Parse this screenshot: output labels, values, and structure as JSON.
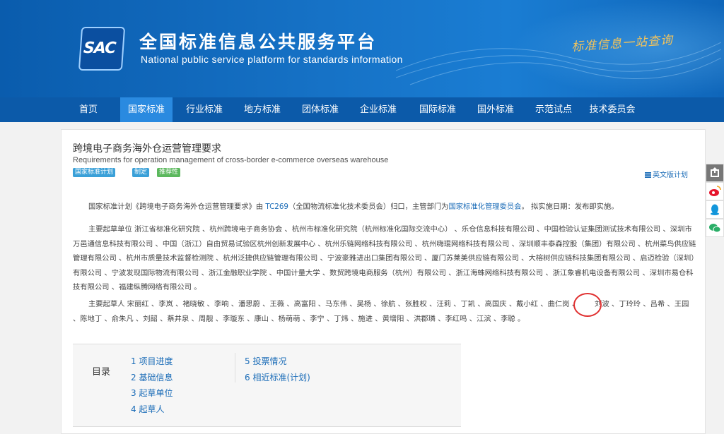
{
  "header": {
    "logo_text": "SAC",
    "title_cn": "全国标准信息公共服务平台",
    "title_en": "National public service platform  for standards information",
    "slogan": "标准信息一站查询"
  },
  "nav": {
    "items": [
      {
        "label": "首页"
      },
      {
        "label": "国家标准"
      },
      {
        "label": "行业标准"
      },
      {
        "label": "地方标准"
      },
      {
        "label": "团体标准"
      },
      {
        "label": "企业标准"
      },
      {
        "label": "国际标准"
      },
      {
        "label": "国外标准"
      },
      {
        "label": "示范试点"
      },
      {
        "label": "技术委员会"
      }
    ],
    "active_index": 1
  },
  "standard": {
    "title": "跨境电子商务海外仓运营管理要求",
    "title_en": "Requirements for operation management of cross-border e-commerce overseas warehouse",
    "tags": [
      "国家标准计划",
      "制定",
      "推荐性"
    ],
    "english_plan_link": "英文版计划"
  },
  "description": {
    "p1_prefix": "国家标准计划《跨境电子商务海外仓运营管理要求》由 ",
    "tc_code": "TC269",
    "p1_mid": "（全国物流标准化技术委员会）归口，主管部门为",
    "dept_link": "国家标准化管理委员会",
    "p1_suffix": "。 拟实施日期：发布即实施。",
    "p2": "主要起草单位 浙江省标准化研究院 、杭州跨境电子商务协会 、杭州市标准化研究院（杭州标准化国际交流中心） 、乐仓信息科技有限公司 、中国检验认证集团测试技术有限公司 、深圳市万邑通信息科技有限公司 、中国（浙江）自由贸易试验区杭州创新发展中心 、杭州乐链网络科技有限公司 、杭州嗨琨网络科技有限公司 、深圳顺丰泰森控股（集团）有限公司 、杭州菜鸟供应链管理有限公司 、杭州市质量技术监督检测院 、杭州泛捷供应链管理有限公司 、宁波豪雅进出口集团有限公司 、厦门苏莱美供应链有限公司 、大榕树供应链科技集团有限公司 、启迈检验（深圳）有限公司 、宁波发现国际物流有限公司 、浙江金融职业学院 、中国计量大学 、数贸跨境电商服务（杭州）有限公司 、浙江海蛛网络科技有限公司 、浙江象睿机电设备有限公司 、深圳市易仓科技有限公司 、福建纵腾网络有限公司 。",
    "p3_prefix": "主要起草人 宋丽红 、李岚 、褚晓敏 、李响 、潘思蔚 、王薇 、高富阳 、马东伟 、吴杨 、徐航 、张胜权 、汪莉 、丁凯 、高国庆 、戴小红 、曲仁岗 、",
    "p3_circled": "刘波",
    "p3_suffix": " 、丁玲玲 、吕希 、王园 、陈地丁 、俞朱凡 、刘韶 、蔡井泉 、周靓 、李璇东 、康山 、杨萌萌 、李宁 、丁炜 、施进 、黄增阳 、洪郡璘 、李红鸣 、江滨 、李聪 。"
  },
  "toc": {
    "label": "目录",
    "items": [
      "1  项目进度",
      "2  基础信息",
      "3  起草单位",
      "4  起草人",
      "5  投票情况",
      "6  相近标准(计划)"
    ]
  },
  "share": {
    "icons": [
      "share-icon",
      "weibo-icon",
      "qq-icon",
      "wechat-icon"
    ]
  }
}
